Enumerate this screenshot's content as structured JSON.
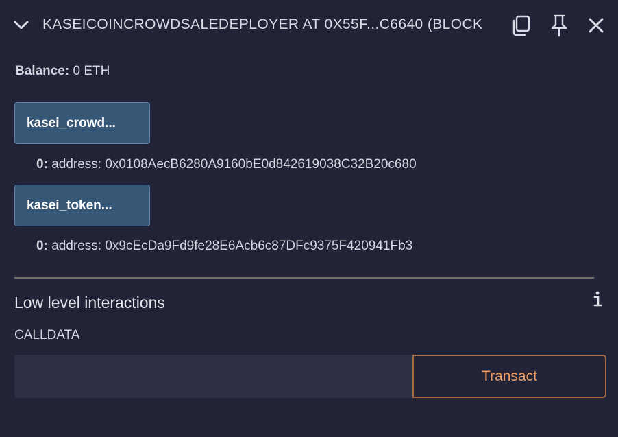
{
  "header": {
    "title": "KASEICOINCROWDSALEDEPLOYER AT 0X55F...C6640 (BLOCK",
    "icons": [
      "chevron-down-icon",
      "copy-icon",
      "pin-icon",
      "close-icon"
    ]
  },
  "balance": {
    "label": "Balance:",
    "value": "0 ETH"
  },
  "functions": [
    {
      "label": "kasei_crowd...",
      "output_index": "0:",
      "output_value": "address: 0x0108AecB6280A9160bE0d842619038C32B20c680"
    },
    {
      "label": "kasei_token...",
      "output_index": "0:",
      "output_value": "address: 0x9cEcDa9Fd9fe28E6Acb6c87DFc9375F420941Fb3"
    }
  ],
  "low_level": {
    "title": "Low level interactions",
    "calldata_label": "CALLDATA",
    "calldata_value": "",
    "transact_label": "Transact"
  },
  "colors": {
    "background": "#222336",
    "button_bg": "#375777",
    "transact_text": "#ef9c63",
    "transact_border": "#a46b46"
  }
}
